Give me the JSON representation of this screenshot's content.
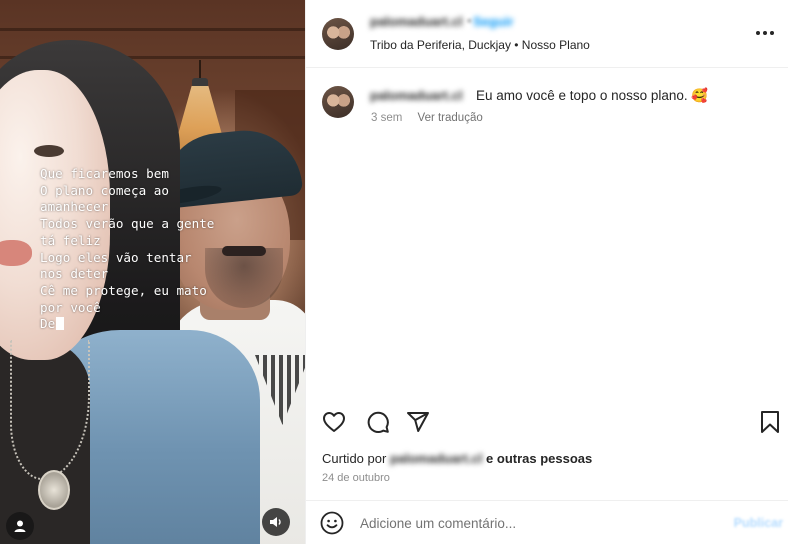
{
  "media": {
    "lyrics": [
      "Que ficaremos bem",
      "O plano começa ao",
      "amanhecer",
      "Todos verão que a gente",
      "tá feliz",
      "Logo eles vão tentar",
      "nos deter",
      "Cê me protege, eu mato",
      "por você",
      "De"
    ],
    "user_tag_icon": "user-icon",
    "mute_icon": "speaker-icon"
  },
  "header": {
    "username": "palomaduart.cl",
    "separator": "•",
    "follow_label": "Seguir",
    "subtitle": "Tribo da Periferia, Duckjay • Nosso Plano",
    "more_icon": "more-icon"
  },
  "caption": {
    "username": "palomaduart.cl",
    "text": "Eu amo você e topo o nosso plano. 🥰",
    "time": "3 sem",
    "translate_label": "Ver tradução"
  },
  "actions": {
    "like_icon": "heart-icon",
    "comment_icon": "comment-icon",
    "share_icon": "share-icon",
    "save_icon": "bookmark-icon"
  },
  "likes": {
    "prefix": "Curtido por",
    "username": "palomaduart.cl",
    "suffix": "e outras pessoas"
  },
  "date": "24 de outubro",
  "composer": {
    "placeholder": "Adicione um comentário...",
    "publish_label": "Publicar",
    "emoji_icon": "smiley-icon"
  },
  "colors": {
    "accent": "#0095f6",
    "publish_disabled": "#b3dbff",
    "muted": "#8e8e8e"
  }
}
